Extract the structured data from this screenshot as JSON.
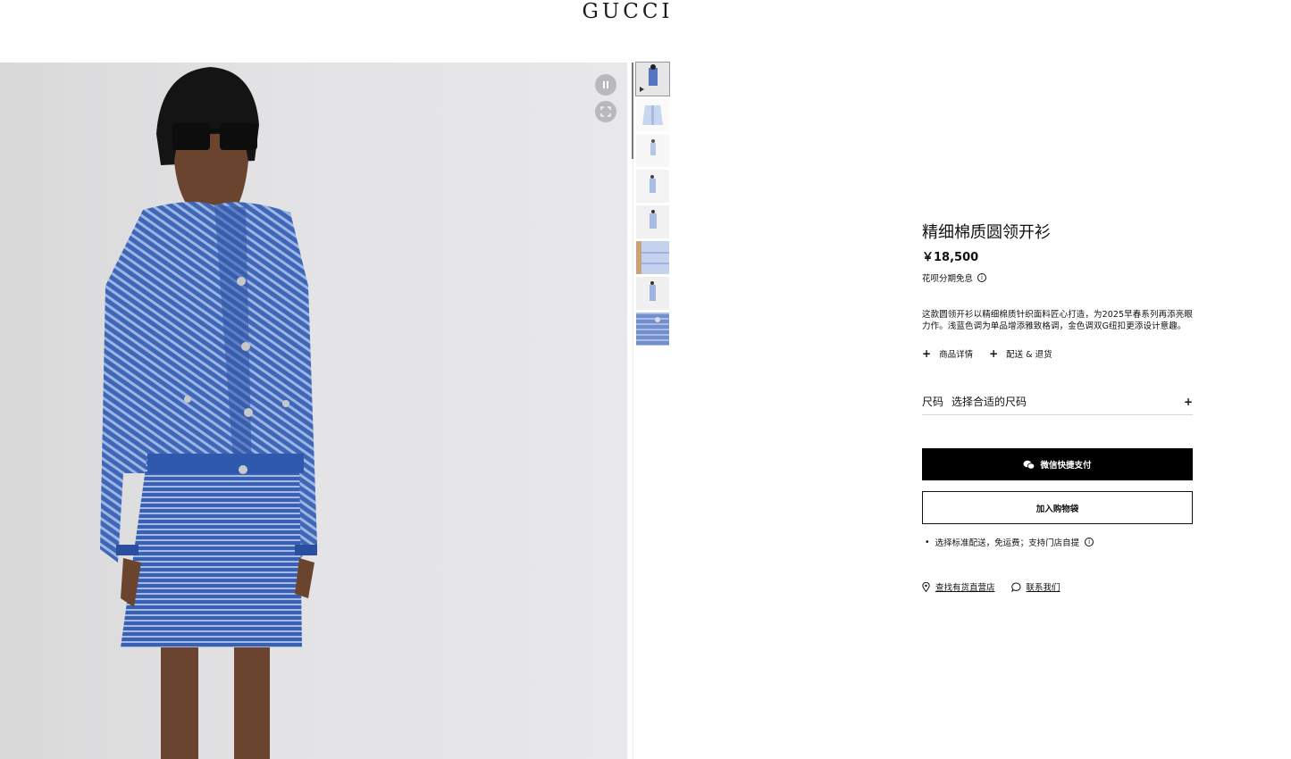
{
  "brand": {
    "logo_text": "GUCCI"
  },
  "gallery": {
    "thumbnails": [
      "look-video-thumbnail",
      "cardigan-flat-thumbnail",
      "back-view-thumbnail",
      "side-view-thumbnail",
      "front-view-thumbnail",
      "fabric-detail-thumbnail",
      "full-look-thumbnail",
      "button-detail-thumbnail"
    ]
  },
  "product": {
    "title": "精细棉质圆领开衫",
    "price": "￥18,500",
    "installment_note": "花呗分期免息",
    "description": "这款圆领开衫以精细棉质针织面料匠心打造，为2025早春系列再添亮眼力作。浅蓝色调为单品增添雅致格调，金色调双G纽扣更添设计意趣。",
    "details_label": "商品详情",
    "shipping_returns_label": "配送 & 退货",
    "size_label": "尺码",
    "size_placeholder": "选择合适的尺码",
    "wechat_pay_label": "微信快捷支付",
    "add_to_bag_label": "加入购物袋",
    "shipping_note": "选择标准配送，免运费；支持门店自提",
    "find_store_label": "查找有货直营店",
    "contact_label": "联系我们"
  },
  "colors": {
    "accent": "#000000",
    "knit_blue": "#3a64b8"
  }
}
